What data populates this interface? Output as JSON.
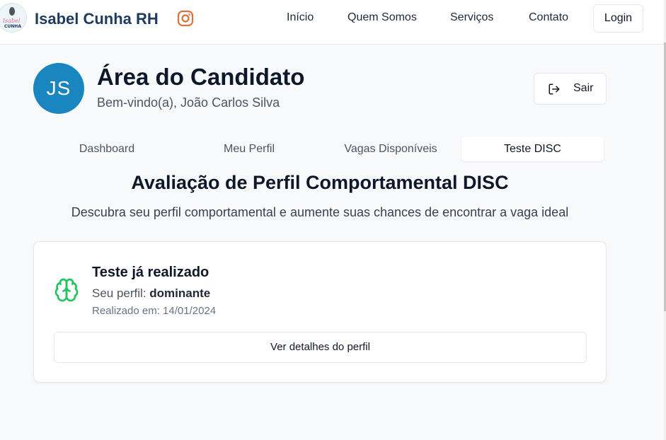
{
  "header": {
    "brand": "Isabel Cunha RH",
    "logo_text": "Isabel CUNHA",
    "nav": [
      "Início",
      "Quem Somos",
      "Serviços",
      "Contato"
    ],
    "login_label": "Login"
  },
  "profile": {
    "initials": "JS",
    "title": "Área do Candidato",
    "welcome": "Bem-vindo(a), João Carlos Silva",
    "logout_label": "Sair"
  },
  "tabs": [
    {
      "label": "Dashboard",
      "active": false
    },
    {
      "label": "Meu Perfil",
      "active": false
    },
    {
      "label": "Vagas Disponíveis",
      "active": false
    },
    {
      "label": "Teste DISC",
      "active": true
    }
  ],
  "disc": {
    "title": "Avaliação de Perfil Comportamental DISC",
    "subtitle": "Descubra seu perfil comportamental e aumente suas chances de encontrar a vaga ideal",
    "card": {
      "title": "Teste já realizado",
      "profile_prefix": "Seu perfil: ",
      "profile_value": "dominante",
      "date_text": "Realizado em: 14/01/2024",
      "button_label": "Ver detalhes do perfil"
    }
  },
  "colors": {
    "accent": "#1a86c0",
    "brand": "#1e3a5f",
    "instagram": "#e1703a",
    "success": "#22c55e"
  },
  "icons": {
    "instagram": "instagram-icon",
    "logout": "logout-icon",
    "brain": "brain-icon"
  }
}
